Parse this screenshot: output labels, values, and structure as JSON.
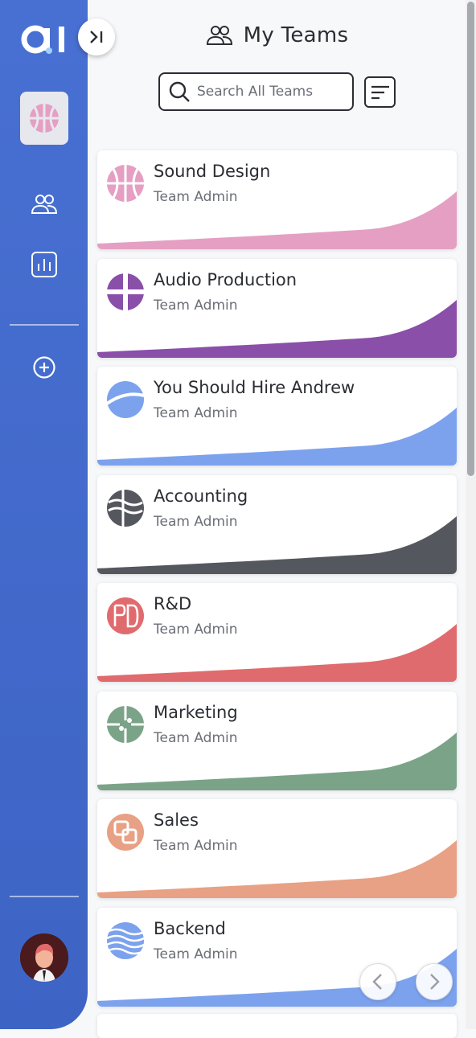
{
  "header": {
    "title": "My Teams"
  },
  "search": {
    "placeholder": "Search All Teams"
  },
  "teams": [
    {
      "name": "Sound Design",
      "role": "Team Admin",
      "color": "#e59fc3",
      "icon": "basketball-icon"
    },
    {
      "name": "Audio Production",
      "role": "Team Admin",
      "color": "#8a4fa8",
      "icon": "cross-circle-icon"
    },
    {
      "name": "You Should Hire Andrew",
      "role": "Team Admin",
      "color": "#7ca2ee",
      "icon": "split-circle-icon"
    },
    {
      "name": "Accounting",
      "role": "Team Admin",
      "color": "#55575e",
      "icon": "waves-circle-icon"
    },
    {
      "name": "R&D",
      "role": "Team Admin",
      "color": "#e06b6e",
      "icon": "pd-circle-icon"
    },
    {
      "name": "Marketing",
      "role": "Team Admin",
      "color": "#7ba388",
      "icon": "circuit-circle-icon"
    },
    {
      "name": "Sales",
      "role": "Team Admin",
      "color": "#e8a184",
      "icon": "squares-circle-icon"
    },
    {
      "name": "Backend",
      "role": "Team Admin",
      "color": "#7ca2ee",
      "icon": "stripes-circle-icon"
    }
  ],
  "colors": {
    "sidebar": "#4870d2",
    "accent": "#4870d2"
  }
}
